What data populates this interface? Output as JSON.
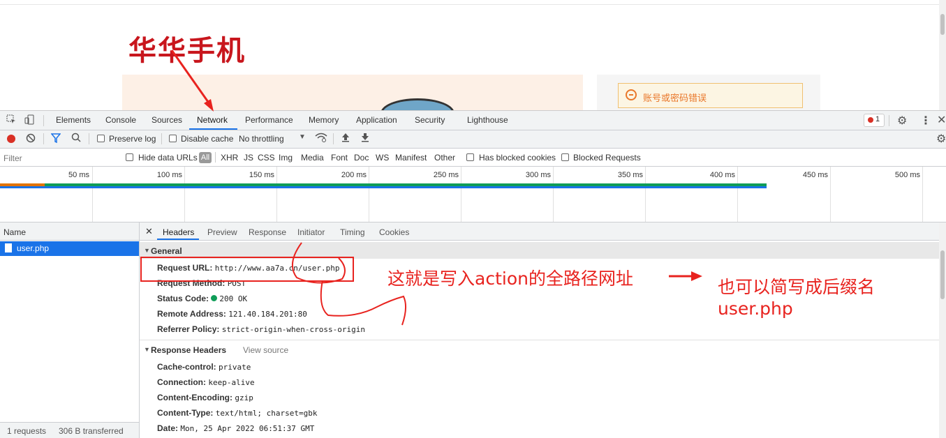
{
  "page": {
    "logo_text": "华华手机",
    "error_message": "账号或密码错误"
  },
  "devtools": {
    "tabs": [
      "Elements",
      "Console",
      "Sources",
      "Network",
      "Performance",
      "Memory",
      "Application",
      "Security",
      "Lighthouse"
    ],
    "active_tab": "Network",
    "error_count": "1",
    "toolbar": {
      "preserve_log": "Preserve log",
      "disable_cache": "Disable cache",
      "throttling": "No throttling"
    },
    "filter": {
      "placeholder": "Filter",
      "hide_data_urls": "Hide data URLs",
      "all": "All",
      "types": [
        "XHR",
        "JS",
        "CSS",
        "Img",
        "Media",
        "Font",
        "Doc",
        "WS",
        "Manifest",
        "Other"
      ],
      "has_blocked_cookies": "Has blocked cookies",
      "blocked_requests": "Blocked Requests"
    },
    "timeline": {
      "ticks": [
        "50 ms",
        "100 ms",
        "150 ms",
        "200 ms",
        "250 ms",
        "300 ms",
        "350 ms",
        "400 ms",
        "450 ms",
        "500 ms"
      ]
    },
    "requests": {
      "column_name": "Name",
      "rows": [
        "user.php"
      ],
      "footer_requests": "1 requests",
      "footer_transferred": "306 B transferred"
    },
    "detail": {
      "tabs": [
        "Headers",
        "Preview",
        "Response",
        "Initiator",
        "Timing",
        "Cookies"
      ],
      "active_tab": "Headers",
      "general_title": "General",
      "general": [
        {
          "key": "Request URL:",
          "value": "http://www.aa7a.cn/user.php"
        },
        {
          "key": "Request Method:",
          "value": "POST"
        },
        {
          "key": "Status Code:",
          "value": "200 OK"
        },
        {
          "key": "Remote Address:",
          "value": "121.40.184.201:80"
        },
        {
          "key": "Referrer Policy:",
          "value": "strict-origin-when-cross-origin"
        }
      ],
      "response_headers_title": "Response Headers",
      "view_source": "View source",
      "response_headers": [
        {
          "key": "Cache-control:",
          "value": "private"
        },
        {
          "key": "Connection:",
          "value": "keep-alive"
        },
        {
          "key": "Content-Encoding:",
          "value": "gzip"
        },
        {
          "key": "Content-Type:",
          "value": "text/html; charset=gbk"
        },
        {
          "key": "Date:",
          "value": "Mon, 25 Apr 2022 06:51:37 GMT"
        }
      ]
    }
  },
  "annotations": {
    "note1": "这就是写入action的全路径网址",
    "note2_line1": "也可以简写成后缀名",
    "note2_line2": "user.php"
  }
}
